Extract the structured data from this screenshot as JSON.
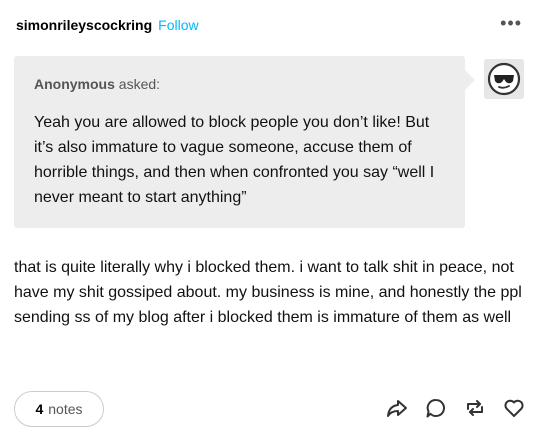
{
  "post": {
    "username": "simonrileyscockring",
    "follow_label": "Follow",
    "menu_label": "•••"
  },
  "ask": {
    "asker_name": "Anonymous",
    "asked_suffix": " asked:",
    "question": "Yeah you are allowed to block people you don’t like! But it’s also immature to vague someone, accuse them of horrible things, and then when confronted you say “well I never meant to start anything”"
  },
  "answer": {
    "text": "that is quite literally why i blocked them. i want to talk shit in peace, not have my shit gossiped about. my business is mine, and honestly the ppl sending ss of my blog after i blocked them is immature of them as well"
  },
  "footer": {
    "notes_count": "4",
    "notes_label": "notes",
    "icons": [
      "share-icon",
      "reply-icon",
      "reblog-icon",
      "like-icon"
    ]
  },
  "colors": {
    "accent": "#00b8ff",
    "ask_background": "#ededed"
  }
}
